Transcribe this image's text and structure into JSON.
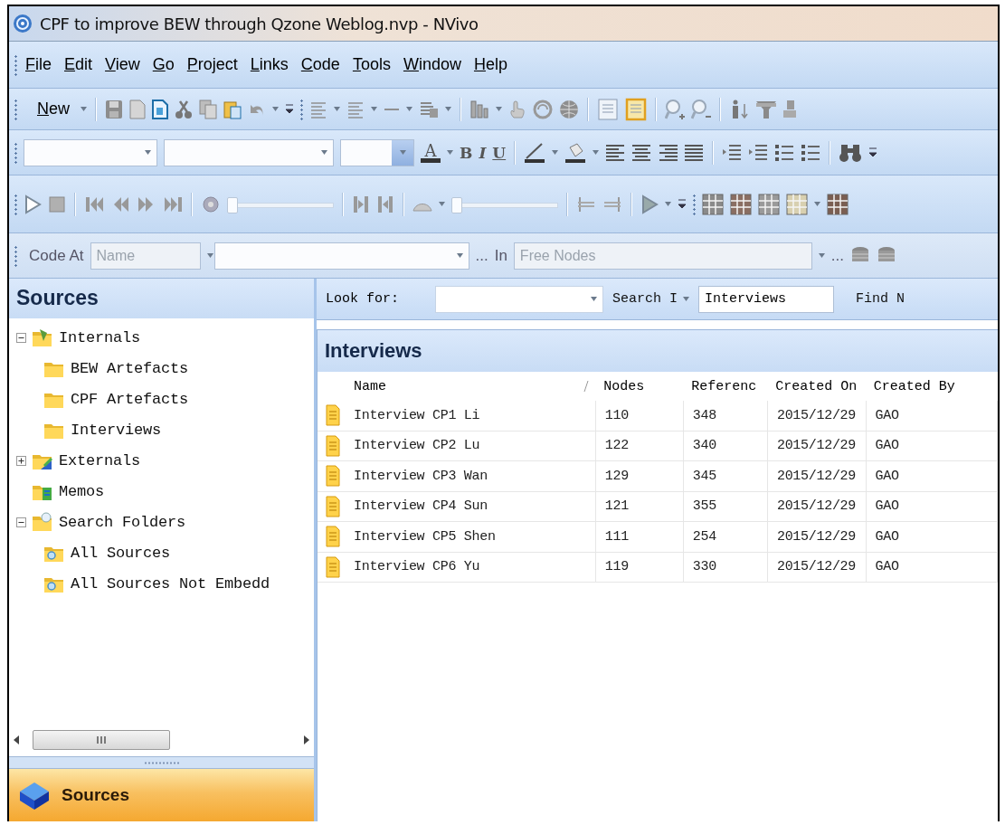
{
  "window": {
    "title": "CPF to improve BEW through Qzone Weblog.nvp - NVivo"
  },
  "menu": [
    "File",
    "Edit",
    "View",
    "Go",
    "Project",
    "Links",
    "Code",
    "Tools",
    "Window",
    "Help"
  ],
  "toolbar": {
    "new_label": "New",
    "layout_buttons": [
      {
        "selected": false
      },
      {
        "selected": true
      }
    ]
  },
  "format_bar": {
    "font_color_glyph": "A",
    "style_glyphs": [
      "B",
      "I",
      "U"
    ]
  },
  "media_bar": {
    "sliders": [
      {
        "level": 0
      },
      {
        "level": 0
      }
    ]
  },
  "code_at_bar": {
    "label": "Code At",
    "name_field": {
      "placeholder": "Name"
    },
    "browse_1": "...",
    "in_label": "In",
    "location_field": {
      "placeholder": "Free Nodes"
    },
    "browse_2": "..."
  },
  "sources_panel": {
    "title": "Sources",
    "tree": [
      {
        "label": "Internals",
        "kind": "internals",
        "expanded": true,
        "children": [
          {
            "label": "BEW Artefacts",
            "kind": "folder"
          },
          {
            "label": "CPF Artefacts",
            "kind": "folder"
          },
          {
            "label": "Interviews",
            "kind": "folder"
          }
        ]
      },
      {
        "label": "Externals",
        "kind": "externals",
        "expanded": false
      },
      {
        "label": "Memos",
        "kind": "memos"
      },
      {
        "label": "Search Folders",
        "kind": "search",
        "expanded": true,
        "children": [
          {
            "label": "All Sources",
            "kind": "search-folder"
          },
          {
            "label": "All Sources Not Embedd",
            "kind": "search-folder"
          }
        ]
      }
    ],
    "nav_buttons": [
      {
        "label": "Sources",
        "selected": true
      }
    ]
  },
  "search_bar": {
    "look_for_label": "Look for:",
    "search_in_button": "Search I",
    "scope_field": {
      "value": "Interviews"
    },
    "find_button": "Find N"
  },
  "list_view": {
    "title": "Interviews",
    "columns": [
      "Name",
      "Nodes",
      "Referenc",
      "Created On",
      "Created By"
    ],
    "rows": [
      [
        "Interview CP1 Li",
        "110",
        "348",
        "2015/12/29",
        "GAO"
      ],
      [
        "Interview CP2 Lu",
        "122",
        "340",
        "2015/12/29",
        "GAO"
      ],
      [
        "Interview CP3 Wan",
        "129",
        "345",
        "2015/12/29",
        "GAO"
      ],
      [
        "Interview CP4 Sun",
        "121",
        "355",
        "2015/12/29",
        "GAO"
      ],
      [
        "Interview CP5 Shen",
        "111",
        "254",
        "2015/12/29",
        "GAO"
      ],
      [
        "Interview CP6 Yu",
        "119",
        "330",
        "2015/12/29",
        "GAO"
      ]
    ]
  }
}
